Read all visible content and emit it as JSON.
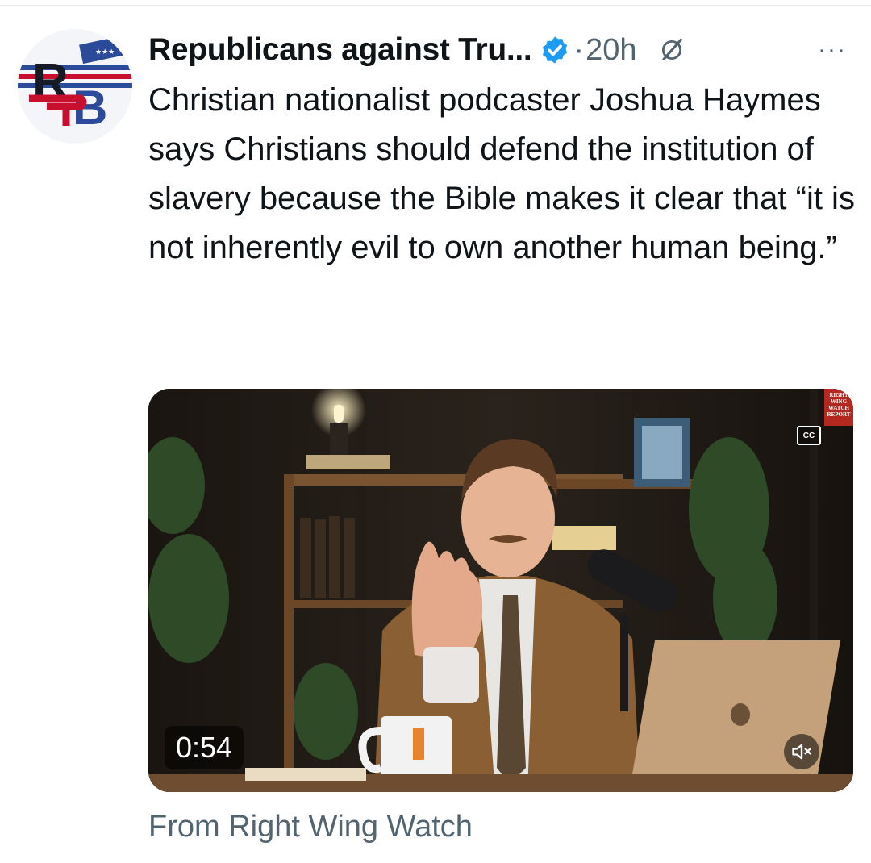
{
  "tweet": {
    "author_name": "Republicans against Tru...",
    "avatar_text": "RB",
    "separator": "·",
    "timestamp": "20h",
    "more_label": "···",
    "text": "Christian nationalist podcaster Joshua Haymes says Christians should defend the institution of slavery because the Bible makes it clear that “it is not inherently evil to own another human being.”",
    "verified_color": "#1d9bf0",
    "icons": [
      "verified-badge-icon",
      "grok-icon",
      "more-icon",
      "closed-captions-icon",
      "mute-icon"
    ]
  },
  "media": {
    "duration": "0:54",
    "cc_label": "CC",
    "watermark_lines": [
      "RIGHT",
      "WING",
      "WATCH",
      "REPORT"
    ]
  },
  "source_attribution": "From Right Wing Watch"
}
